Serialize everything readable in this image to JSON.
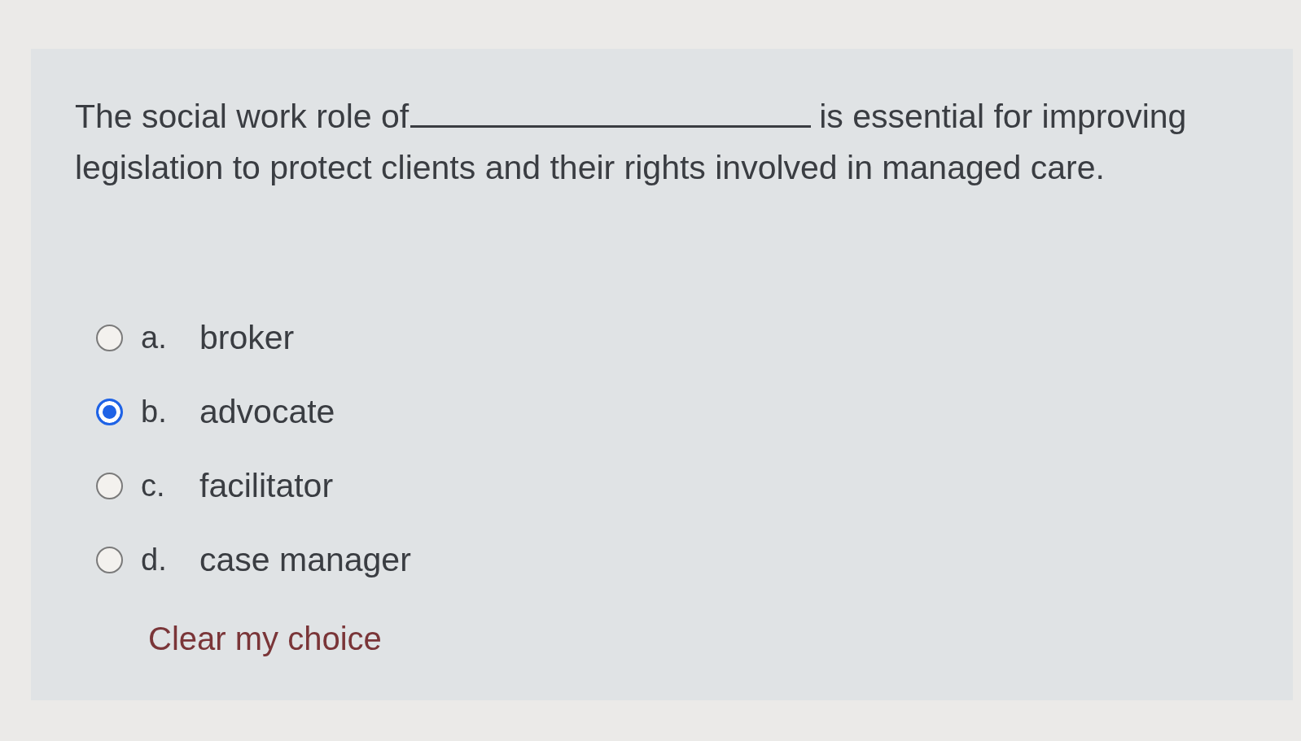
{
  "question": {
    "before_blank": "The social work role of",
    "after_blank": "is essential for improving legislation to protect clients and their rights involved in managed care."
  },
  "options": [
    {
      "letter": "a.",
      "label": "broker",
      "selected": false
    },
    {
      "letter": "b.",
      "label": "advocate",
      "selected": true
    },
    {
      "letter": "c.",
      "label": "facilitator",
      "selected": false
    },
    {
      "letter": "d.",
      "label": "case manager",
      "selected": false
    }
  ],
  "clear_link": "Clear my choice"
}
